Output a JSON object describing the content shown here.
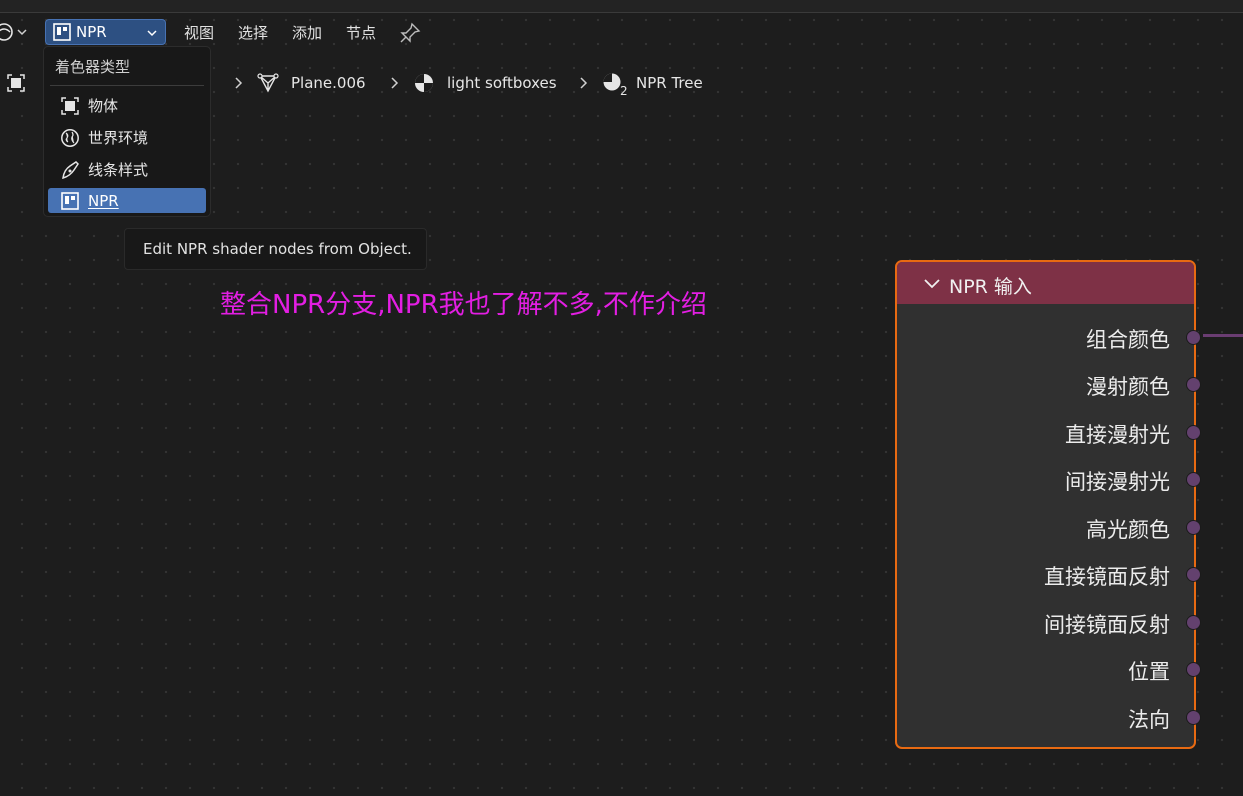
{
  "header": {
    "editor_type_icon": "node-editor-circle-icon",
    "shader_type_select": {
      "label": "NPR",
      "icon": "npr-icon"
    },
    "menus": [
      "视图",
      "选择",
      "添加",
      "节点"
    ],
    "pin_icon": "pin-icon"
  },
  "breadcrumb": {
    "items": [
      {
        "label": "Plane.006",
        "icon": "mesh-icon"
      },
      {
        "label": "light softboxes",
        "icon": "material-icon"
      },
      {
        "label": "NPR Tree",
        "icon": "node-tree-icon",
        "badge": "2"
      }
    ]
  },
  "dropdown": {
    "title": "着色器类型",
    "items": [
      {
        "label": "物体",
        "icon": "object-icon",
        "active": false
      },
      {
        "label": "世界环境",
        "icon": "world-icon",
        "active": false
      },
      {
        "label": "线条样式",
        "icon": "linestyle-icon",
        "active": false
      },
      {
        "label": "NPR",
        "icon": "npr-icon",
        "active": true
      }
    ]
  },
  "tooltip": {
    "text": "Edit NPR shader nodes from Object."
  },
  "annotation": {
    "text": "整合NPR分支,NPR我也了解不多,不作介绍",
    "color": "#e31ee3"
  },
  "node": {
    "title": "NPR 输入",
    "header_color": "#7e3146",
    "border_color": "#e86a12",
    "outputs": [
      "组合颜色",
      "漫射颜色",
      "直接漫射光",
      "间接漫射光",
      "高光颜色",
      "直接镜面反射",
      "间接镜面反射",
      "位置",
      "法向"
    ]
  },
  "colors": {
    "background": "#1d1d1d",
    "accent": "#4772b3",
    "socket": "#63416e"
  }
}
